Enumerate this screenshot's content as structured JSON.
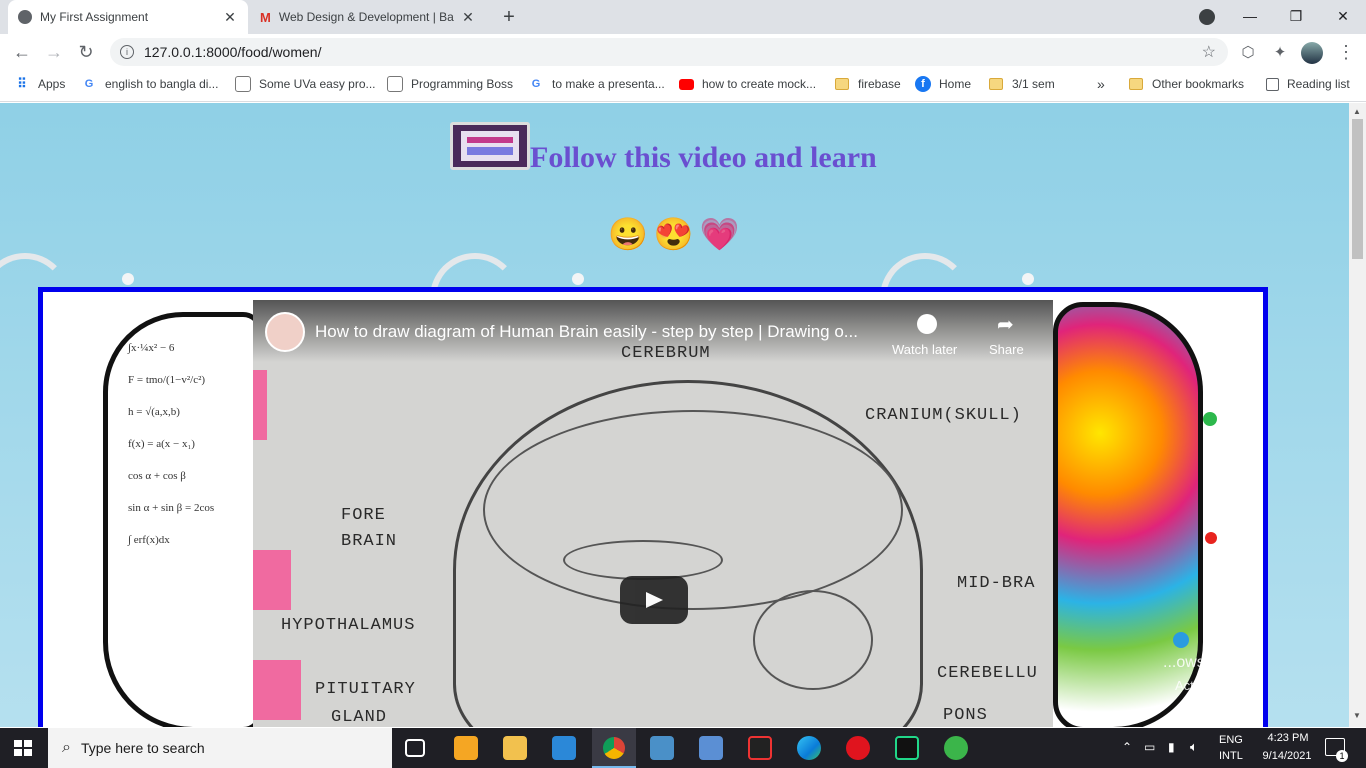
{
  "browser": {
    "tabs": [
      {
        "title": "My First Assignment",
        "active": true,
        "icon": "globe-icon"
      },
      {
        "title": "Web Design & Development | Ba",
        "active": false,
        "icon": "gmail-icon"
      }
    ],
    "url": "127.0.0.1:8000/food/women/",
    "bookmarks": [
      {
        "label": "Apps",
        "icon": "apps-grid-icon"
      },
      {
        "label": "english to bangla di...",
        "icon": "google-icon"
      },
      {
        "label": "Some UVa easy pro...",
        "icon": "site-icon"
      },
      {
        "label": "Programming Boss",
        "icon": "site-icon"
      },
      {
        "label": "to make a presenta...",
        "icon": "google-icon"
      },
      {
        "label": "how to create mock...",
        "icon": "youtube-icon"
      },
      {
        "label": "firebase",
        "icon": "folder-icon"
      },
      {
        "label": "Home",
        "icon": "facebook-icon"
      },
      {
        "label": "3/1 sem",
        "icon": "folder-icon"
      }
    ],
    "overflow_label": "»",
    "other_bookmarks": "Other bookmarks",
    "reading_list": "Reading list"
  },
  "page": {
    "heading": "Follow this video and learn",
    "emojis": "😀😍💗"
  },
  "video": {
    "title": "How to draw diagram of Human Brain easily - step by step | Drawing o...",
    "watch_later": "Watch later",
    "share": "Share",
    "labels": {
      "cerebrum": "CEREBRUM",
      "cranium": "CRANIUM(SKULL)",
      "fore_brain_1": "FORE",
      "fore_brain_2": "BRAIN",
      "mid_brain": "MID-BRA",
      "hypothalamus": "HYPOTHALAMUS",
      "cerebellum": "CEREBELLU",
      "pituitary_1": "PITUITARY",
      "pituitary_2": "GLAND",
      "pons": "PONS"
    }
  },
  "watermark": {
    "line1": "...ows",
    "line2": "Activate Windows"
  },
  "taskbar": {
    "search_placeholder": "Type here to search",
    "lang_1": "ENG",
    "lang_2": "INTL",
    "time": "4:23 PM",
    "date": "9/14/2021",
    "notifications": "1"
  }
}
